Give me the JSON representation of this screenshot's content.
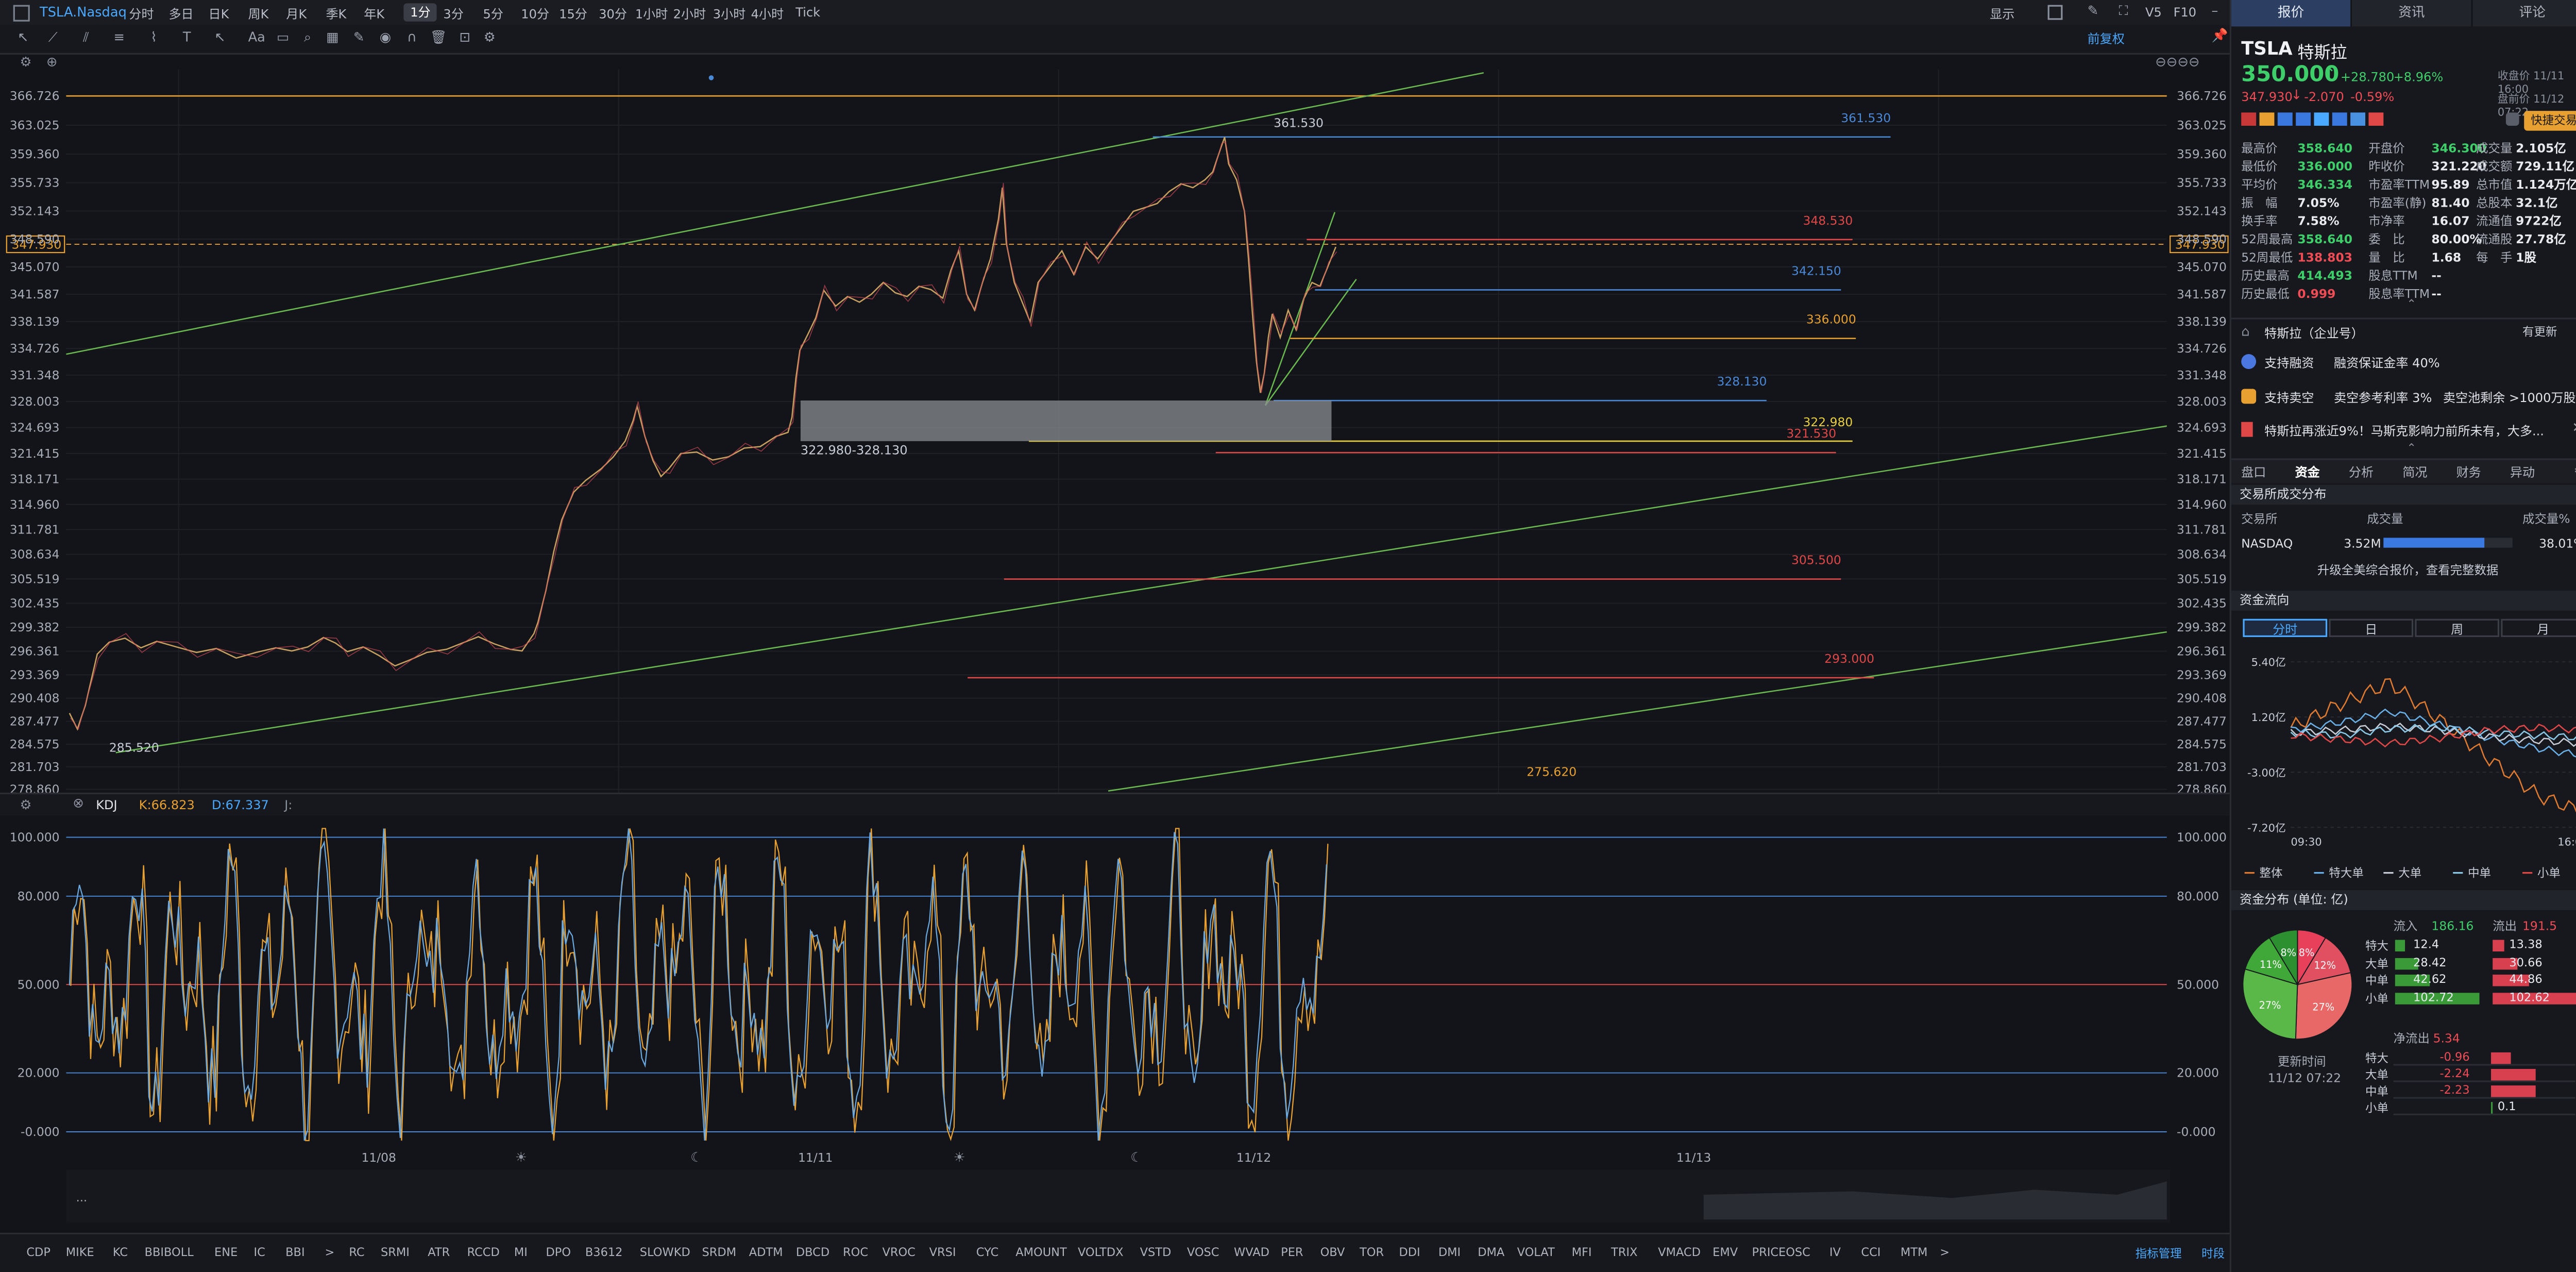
{
  "header": {
    "symbol": "TSLA.Nasdaq",
    "timeframes": [
      "分时",
      "多日",
      "日K",
      "周K",
      "月K",
      "季K",
      "年K",
      "1分",
      "3分",
      "5分",
      "10分",
      "15分",
      "30分",
      "1小时",
      "2小时",
      "3小时",
      "4小时",
      "Tick"
    ],
    "selected_tf": "1分",
    "right_tools": [
      "显示",
      "V5",
      "F10"
    ],
    "restore_label": "前复权"
  },
  "quote": {
    "tabs": [
      "报价",
      "资讯",
      "评论"
    ],
    "symbol": "TSLA",
    "name": "特斯拉",
    "price": "350.000",
    "arrow": "↑",
    "change": "+28.780",
    "change_pct": "+8.96%",
    "close_note": "收盘价 11/11 16:00",
    "post_price": "347.930",
    "post_arrow": "↓",
    "post_change": "-2.070",
    "post_pct": "-0.59%",
    "post_note": "盘前价 11/12 07:22",
    "quick_trade": "快捷交易",
    "stats": [
      [
        "最高价",
        "358.640",
        "green",
        "开盘价",
        "346.300",
        "green",
        "成交量",
        "2.105亿",
        ""
      ],
      [
        "最低价",
        "336.000",
        "green",
        "昨收价",
        "321.220",
        "",
        "成交额",
        "729.11亿",
        ""
      ],
      [
        "平均价",
        "346.334",
        "green",
        "市盈率TTM",
        "95.89",
        "",
        "总市值",
        "1.124万亿",
        ""
      ],
      [
        "振　幅",
        "7.05%",
        "",
        "市盈率(静)",
        "81.40",
        "",
        "总股本",
        "32.1亿",
        ""
      ],
      [
        "换手率",
        "7.58%",
        "",
        "市净率",
        "16.07",
        "",
        "流通值",
        "9722亿",
        ""
      ],
      [
        "52周最高",
        "358.640",
        "green",
        "委　比",
        "80.00%",
        "",
        "流通股",
        "27.78亿",
        ""
      ],
      [
        "52周最低",
        "138.803",
        "red",
        "量　比",
        "1.68",
        "",
        "每　手",
        "1股",
        ""
      ],
      [
        "历史最高",
        "414.493",
        "green",
        "股息TTM",
        "--",
        "",
        "",
        "",
        ""
      ],
      [
        "历史最低",
        "0.999",
        "red",
        "股息率TTM",
        "--",
        "",
        "",
        "",
        ""
      ]
    ],
    "company": "特斯拉（企业号）",
    "company_update": "有更新",
    "margin": "支持融资",
    "margin_ratio": "融资保证金率 40%",
    "short": "支持卖空",
    "short_rate": "卖空参考利率 3%",
    "short_pool": "卖空池剩余 >1000万股",
    "news": "特斯拉再涨近9%！马斯克影响力前所未有，大多...",
    "subtabs": [
      "盘口",
      "资金",
      "分析",
      "简况",
      "财务",
      "异动"
    ],
    "subtab_sel": "资金",
    "exch_title": "交易所成交分布",
    "exch_cols": [
      "交易所",
      "成交量",
      "成交量%"
    ],
    "exch_name": "NASDAQ",
    "exch_vol": "3.52M",
    "exch_pct": "38.01%",
    "exch_pct_value": 0.3801,
    "upgrade": "升级全美综合报价，查看完整数据",
    "flow_title": "资金流向",
    "flow_tabs": [
      "分时",
      "日",
      "周",
      "月"
    ],
    "flow_y": [
      "5.40亿",
      "1.20亿",
      "-3.00亿",
      "-7.20亿"
    ],
    "flow_x": [
      "09:30",
      "16:00"
    ],
    "flow_legend": [
      "整体",
      "特大单",
      "大单",
      "中单",
      "小单"
    ],
    "dist_title": "资金分布 (单位: 亿)",
    "inflow_label": "流入",
    "inflow": "186.16",
    "outflow_label": "流出",
    "outflow": "191.5",
    "dist_rows": [
      [
        "特大",
        "12.4",
        "13.38"
      ],
      [
        "大单",
        "28.42",
        "30.66"
      ],
      [
        "中单",
        "42.62",
        "44.86"
      ],
      [
        "小单",
        "102.72",
        "102.62"
      ]
    ],
    "pie_labels": [
      "8%",
      "12%",
      "27%",
      "27%",
      "11%",
      "8%"
    ],
    "net_label": "净流出",
    "net": "5.34",
    "net_rows": [
      [
        "特大",
        "-0.96"
      ],
      [
        "大单",
        "-2.24"
      ],
      [
        "中单",
        "-2.23"
      ],
      [
        "小单",
        "0.1"
      ]
    ],
    "update_label": "更新时间",
    "update_time": "11/12 07:22"
  },
  "indicator": {
    "name": "KDJ",
    "k": "K:66.823",
    "d": "D:67.337",
    "j": "J:"
  },
  "bottom_indicators": [
    "CDP",
    "MIKE",
    "KC",
    "BBIBOLL",
    "ENE",
    "IC",
    "BBI",
    ">",
    "RC",
    "SRMI",
    "ATR",
    "RCCD",
    "MI",
    "DPO",
    "B3612",
    "SLOWKD",
    "SRDM",
    "ADTM",
    "DBCD",
    "ROC",
    "VROC",
    "VRSI",
    "CYC",
    "AMOUNT",
    "VOLTDX",
    "VSTD",
    "VOSC",
    "WVAD",
    "PER",
    "OBV",
    "TOR",
    "DDI",
    "DMI",
    "DMA",
    "VOLAT",
    "MFI",
    "TRIX",
    "VMACD",
    "EMV",
    "PRICEOSC",
    "IV",
    "CCI",
    "MTM",
    ">"
  ],
  "bottom_right": [
    "指标管理",
    "时段"
  ],
  "chart_data": [
    {
      "type": "line",
      "title": "",
      "ylabel": "",
      "price_axis": [
        "366.726",
        "363.025",
        "359.360",
        "355.733",
        "352.143",
        "348.590",
        "345.070",
        "341.587",
        "338.139",
        "334.726",
        "331.348",
        "328.003",
        "324.693",
        "321.415",
        "318.171",
        "314.960",
        "311.781",
        "308.634",
        "305.519",
        "302.435",
        "299.382",
        "296.361",
        "293.369",
        "290.408",
        "287.477",
        "284.575",
        "281.703",
        "278.860"
      ],
      "current_price": "347.930",
      "date_labels": [
        "11/08",
        "11/11",
        "11/12",
        "11/13"
      ],
      "levels": [
        {
          "price": "361.530",
          "color": "#4a88d8"
        },
        {
          "price": "348.530",
          "color": "#e04848"
        },
        {
          "price": "342.150",
          "color": "#4a88d8"
        },
        {
          "price": "336.000",
          "color": "#e8a030"
        },
        {
          "price": "328.130",
          "color": "#4a88d8"
        },
        {
          "price": "322.980",
          "color": "#e8d040"
        },
        {
          "price": "321.530",
          "color": "#e04848"
        },
        {
          "price": "305.500",
          "color": "#e04848"
        },
        {
          "price": "293.000",
          "color": "#e04848"
        },
        {
          "price": "275.620",
          "color": "#e8a030"
        }
      ],
      "gap_label": "322.980-328.130",
      "low_label": "285.520",
      "high_label": "361.530",
      "path_points": [
        [
          0,
          288.5
        ],
        [
          2,
          286.5
        ],
        [
          4,
          289.5
        ],
        [
          7,
          296
        ],
        [
          10,
          297.5
        ],
        [
          14,
          298
        ],
        [
          18,
          296.8
        ],
        [
          22,
          297.6
        ],
        [
          27,
          296.9
        ],
        [
          32,
          296.2
        ],
        [
          37,
          296.7
        ],
        [
          42,
          295.5
        ],
        [
          47,
          296.2
        ],
        [
          52,
          296.8
        ],
        [
          56,
          296.4
        ],
        [
          60,
          296.9
        ],
        [
          64,
          298.1
        ],
        [
          67,
          297.4
        ],
        [
          70,
          296.3
        ],
        [
          74,
          296.9
        ],
        [
          78,
          295.8
        ],
        [
          82,
          294.5
        ],
        [
          86,
          295.3
        ],
        [
          90,
          296.2
        ],
        [
          95,
          296.6
        ],
        [
          99,
          297.4
        ],
        [
          103,
          298.2
        ],
        [
          107,
          297.3
        ],
        [
          111,
          296.6
        ],
        [
          114,
          296.4
        ],
        [
          117,
          298.6
        ],
        [
          118,
          300
        ],
        [
          120,
          304
        ],
        [
          122,
          309
        ],
        [
          124,
          313
        ],
        [
          127,
          316.5
        ],
        [
          130,
          318
        ],
        [
          134,
          319.5
        ],
        [
          137,
          321
        ],
        [
          140,
          323
        ],
        [
          142,
          325.6
        ],
        [
          143,
          327.4
        ],
        [
          145,
          323.5
        ],
        [
          147,
          320.5
        ],
        [
          149,
          318.5
        ],
        [
          151,
          319.5
        ],
        [
          154,
          321.4
        ],
        [
          158,
          321.6
        ],
        [
          162,
          320.6
        ],
        [
          166,
          321
        ],
        [
          170,
          322.1
        ],
        [
          174,
          322.3
        ],
        [
          178,
          323.6
        ],
        [
          181,
          324.1
        ],
        [
          182,
          326
        ],
        [
          183,
          331
        ],
        [
          184,
          334.5
        ],
        [
          186,
          336.5
        ],
        [
          188,
          338.6
        ],
        [
          190,
          342.1
        ],
        [
          193,
          340.1
        ],
        [
          196,
          341.3
        ],
        [
          199,
          340.6
        ],
        [
          202,
          341.6
        ],
        [
          205,
          343.1
        ],
        [
          208,
          341.8
        ],
        [
          211,
          341.3
        ],
        [
          214,
          342.6
        ],
        [
          217,
          342.2
        ],
        [
          220,
          341.1
        ],
        [
          222,
          344.6
        ],
        [
          224,
          347.1
        ],
        [
          226,
          341.6
        ],
        [
          228,
          339.6
        ],
        [
          230,
          343.1
        ],
        [
          232,
          346.1
        ],
        [
          234,
          351.1
        ],
        [
          235,
          355.1
        ],
        [
          236,
          348.1
        ],
        [
          238,
          343.1
        ],
        [
          240,
          340.6
        ],
        [
          242,
          338.1
        ],
        [
          244,
          343.1
        ],
        [
          247,
          345.1
        ],
        [
          250,
          347.1
        ],
        [
          253,
          344.1
        ],
        [
          256,
          347.6
        ],
        [
          259,
          346.1
        ],
        [
          262,
          348.1
        ],
        [
          265,
          350.1
        ],
        [
          268,
          352.1
        ],
        [
          271,
          352.6
        ],
        [
          274,
          353.1
        ],
        [
          277,
          354.6
        ],
        [
          280,
          355.6
        ],
        [
          283,
          355.1
        ],
        [
          286,
          356.1
        ],
        [
          288,
          357.1
        ],
        [
          290,
          360.1
        ],
        [
          291,
          361.5
        ],
        [
          292,
          358.1
        ],
        [
          294,
          356.1
        ],
        [
          296,
          352.1
        ],
        [
          297,
          346.1
        ],
        [
          298,
          339.1
        ],
        [
          299,
          333.1
        ],
        [
          300,
          329.1
        ],
        [
          301,
          331.6
        ],
        [
          302,
          336.1
        ],
        [
          303,
          339.1
        ],
        [
          305,
          336.1
        ],
        [
          307,
          339.6
        ],
        [
          309,
          337.1
        ],
        [
          311,
          341.1
        ],
        [
          313,
          343.1
        ],
        [
          315,
          342.6
        ],
        [
          317,
          345.1
        ],
        [
          319,
          347.6
        ]
      ],
      "kdj_axis": [
        "100.000",
        "80.000",
        "50.000",
        "20.000",
        "-0.000"
      ]
    },
    {
      "type": "line",
      "title": "资金流向",
      "series": [
        {
          "name": "整体"
        },
        {
          "name": "特大单"
        },
        {
          "name": "大单"
        },
        {
          "name": "中单"
        },
        {
          "name": "小单"
        }
      ],
      "x": [
        "09:30",
        "16:00"
      ],
      "y_ticks": [
        "5.40亿",
        "1.20亿",
        "-3.00亿",
        "-7.20亿"
      ]
    },
    {
      "type": "pie",
      "title": "资金分布",
      "values": [
        8,
        12,
        27,
        27,
        11,
        8
      ]
    }
  ]
}
